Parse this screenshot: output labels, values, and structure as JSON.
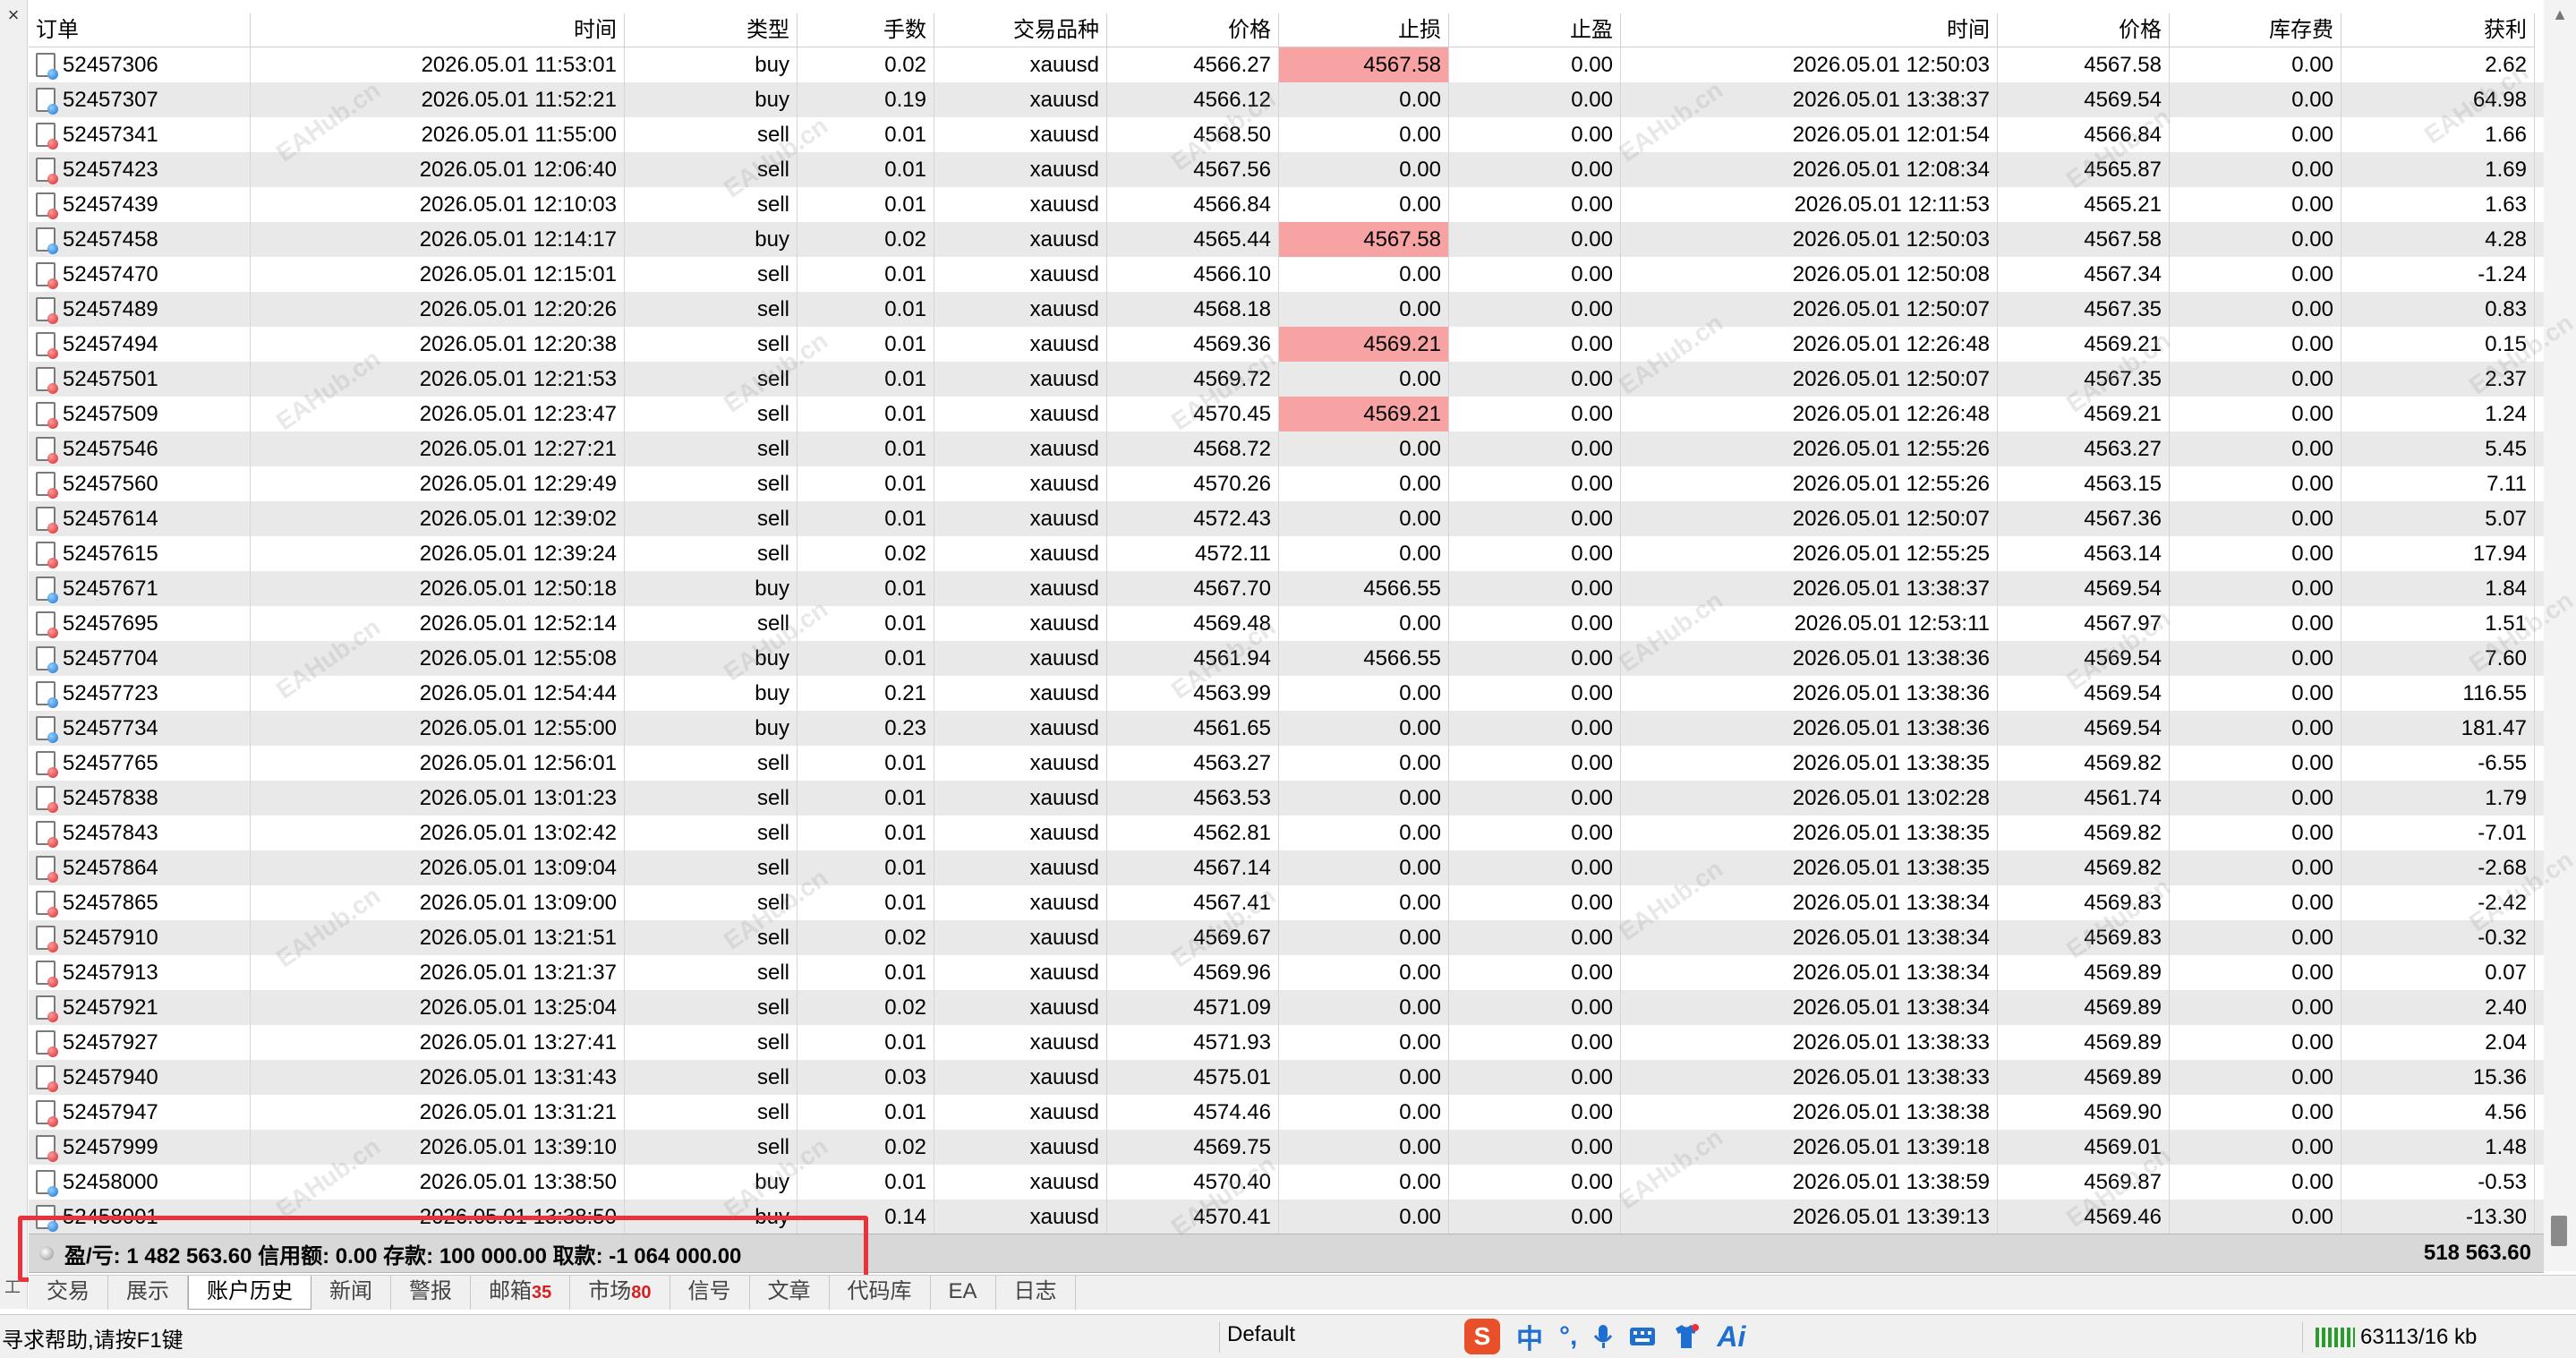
{
  "toolbox": {
    "close_glyph": "×",
    "title": "工具箱"
  },
  "columns": [
    "订单",
    "时间",
    "类型",
    "手数",
    "交易品种",
    "价格",
    "止损",
    "止盈",
    "时间",
    "价格",
    "库存费",
    "获利"
  ],
  "rows": [
    {
      "order": "52457306",
      "open_time": "2026.05.01 11:53:01",
      "type": "buy",
      "lots": "0.02",
      "symbol": "xauusd",
      "open_price": "4566.27",
      "sl": "4567.58",
      "sl_hit": true,
      "tp": "0.00",
      "close_time": "2026.05.01 12:50:03",
      "close_price": "4567.58",
      "swap": "0.00",
      "profit": "2.62"
    },
    {
      "order": "52457307",
      "open_time": "2026.05.01 11:52:21",
      "type": "buy",
      "lots": "0.19",
      "symbol": "xauusd",
      "open_price": "4566.12",
      "sl": "0.00",
      "sl_hit": false,
      "tp": "0.00",
      "close_time": "2026.05.01 13:38:37",
      "close_price": "4569.54",
      "swap": "0.00",
      "profit": "64.98"
    },
    {
      "order": "52457341",
      "open_time": "2026.05.01 11:55:00",
      "type": "sell",
      "lots": "0.01",
      "symbol": "xauusd",
      "open_price": "4568.50",
      "sl": "0.00",
      "sl_hit": false,
      "tp": "0.00",
      "close_time": "2026.05.01 12:01:54",
      "close_price": "4566.84",
      "swap": "0.00",
      "profit": "1.66"
    },
    {
      "order": "52457423",
      "open_time": "2026.05.01 12:06:40",
      "type": "sell",
      "lots": "0.01",
      "symbol": "xauusd",
      "open_price": "4567.56",
      "sl": "0.00",
      "sl_hit": false,
      "tp": "0.00",
      "close_time": "2026.05.01 12:08:34",
      "close_price": "4565.87",
      "swap": "0.00",
      "profit": "1.69"
    },
    {
      "order": "52457439",
      "open_time": "2026.05.01 12:10:03",
      "type": "sell",
      "lots": "0.01",
      "symbol": "xauusd",
      "open_price": "4566.84",
      "sl": "0.00",
      "sl_hit": false,
      "tp": "0.00",
      "close_time": "2026.05.01 12:11:53",
      "close_price": "4565.21",
      "swap": "0.00",
      "profit": "1.63"
    },
    {
      "order": "52457458",
      "open_time": "2026.05.01 12:14:17",
      "type": "buy",
      "lots": "0.02",
      "symbol": "xauusd",
      "open_price": "4565.44",
      "sl": "4567.58",
      "sl_hit": true,
      "tp": "0.00",
      "close_time": "2026.05.01 12:50:03",
      "close_price": "4567.58",
      "swap": "0.00",
      "profit": "4.28"
    },
    {
      "order": "52457470",
      "open_time": "2026.05.01 12:15:01",
      "type": "sell",
      "lots": "0.01",
      "symbol": "xauusd",
      "open_price": "4566.10",
      "sl": "0.00",
      "sl_hit": false,
      "tp": "0.00",
      "close_time": "2026.05.01 12:50:08",
      "close_price": "4567.34",
      "swap": "0.00",
      "profit": "-1.24"
    },
    {
      "order": "52457489",
      "open_time": "2026.05.01 12:20:26",
      "type": "sell",
      "lots": "0.01",
      "symbol": "xauusd",
      "open_price": "4568.18",
      "sl": "0.00",
      "sl_hit": false,
      "tp": "0.00",
      "close_time": "2026.05.01 12:50:07",
      "close_price": "4567.35",
      "swap": "0.00",
      "profit": "0.83"
    },
    {
      "order": "52457494",
      "open_time": "2026.05.01 12:20:38",
      "type": "sell",
      "lots": "0.01",
      "symbol": "xauusd",
      "open_price": "4569.36",
      "sl": "4569.21",
      "sl_hit": true,
      "tp": "0.00",
      "close_time": "2026.05.01 12:26:48",
      "close_price": "4569.21",
      "swap": "0.00",
      "profit": "0.15"
    },
    {
      "order": "52457501",
      "open_time": "2026.05.01 12:21:53",
      "type": "sell",
      "lots": "0.01",
      "symbol": "xauusd",
      "open_price": "4569.72",
      "sl": "0.00",
      "sl_hit": false,
      "tp": "0.00",
      "close_time": "2026.05.01 12:50:07",
      "close_price": "4567.35",
      "swap": "0.00",
      "profit": "2.37"
    },
    {
      "order": "52457509",
      "open_time": "2026.05.01 12:23:47",
      "type": "sell",
      "lots": "0.01",
      "symbol": "xauusd",
      "open_price": "4570.45",
      "sl": "4569.21",
      "sl_hit": true,
      "tp": "0.00",
      "close_time": "2026.05.01 12:26:48",
      "close_price": "4569.21",
      "swap": "0.00",
      "profit": "1.24"
    },
    {
      "order": "52457546",
      "open_time": "2026.05.01 12:27:21",
      "type": "sell",
      "lots": "0.01",
      "symbol": "xauusd",
      "open_price": "4568.72",
      "sl": "0.00",
      "sl_hit": false,
      "tp": "0.00",
      "close_time": "2026.05.01 12:55:26",
      "close_price": "4563.27",
      "swap": "0.00",
      "profit": "5.45"
    },
    {
      "order": "52457560",
      "open_time": "2026.05.01 12:29:49",
      "type": "sell",
      "lots": "0.01",
      "symbol": "xauusd",
      "open_price": "4570.26",
      "sl": "0.00",
      "sl_hit": false,
      "tp": "0.00",
      "close_time": "2026.05.01 12:55:26",
      "close_price": "4563.15",
      "swap": "0.00",
      "profit": "7.11"
    },
    {
      "order": "52457614",
      "open_time": "2026.05.01 12:39:02",
      "type": "sell",
      "lots": "0.01",
      "symbol": "xauusd",
      "open_price": "4572.43",
      "sl": "0.00",
      "sl_hit": false,
      "tp": "0.00",
      "close_time": "2026.05.01 12:50:07",
      "close_price": "4567.36",
      "swap": "0.00",
      "profit": "5.07"
    },
    {
      "order": "52457615",
      "open_time": "2026.05.01 12:39:24",
      "type": "sell",
      "lots": "0.02",
      "symbol": "xauusd",
      "open_price": "4572.11",
      "sl": "0.00",
      "sl_hit": false,
      "tp": "0.00",
      "close_time": "2026.05.01 12:55:25",
      "close_price": "4563.14",
      "swap": "0.00",
      "profit": "17.94"
    },
    {
      "order": "52457671",
      "open_time": "2026.05.01 12:50:18",
      "type": "buy",
      "lots": "0.01",
      "symbol": "xauusd",
      "open_price": "4567.70",
      "sl": "4566.55",
      "sl_hit": false,
      "tp": "0.00",
      "close_time": "2026.05.01 13:38:37",
      "close_price": "4569.54",
      "swap": "0.00",
      "profit": "1.84"
    },
    {
      "order": "52457695",
      "open_time": "2026.05.01 12:52:14",
      "type": "sell",
      "lots": "0.01",
      "symbol": "xauusd",
      "open_price": "4569.48",
      "sl": "0.00",
      "sl_hit": false,
      "tp": "0.00",
      "close_time": "2026.05.01 12:53:11",
      "close_price": "4567.97",
      "swap": "0.00",
      "profit": "1.51"
    },
    {
      "order": "52457704",
      "open_time": "2026.05.01 12:55:08",
      "type": "buy",
      "lots": "0.01",
      "symbol": "xauusd",
      "open_price": "4561.94",
      "sl": "4566.55",
      "sl_hit": false,
      "tp": "0.00",
      "close_time": "2026.05.01 13:38:36",
      "close_price": "4569.54",
      "swap": "0.00",
      "profit": "7.60"
    },
    {
      "order": "52457723",
      "open_time": "2026.05.01 12:54:44",
      "type": "buy",
      "lots": "0.21",
      "symbol": "xauusd",
      "open_price": "4563.99",
      "sl": "0.00",
      "sl_hit": false,
      "tp": "0.00",
      "close_time": "2026.05.01 13:38:36",
      "close_price": "4569.54",
      "swap": "0.00",
      "profit": "116.55"
    },
    {
      "order": "52457734",
      "open_time": "2026.05.01 12:55:00",
      "type": "buy",
      "lots": "0.23",
      "symbol": "xauusd",
      "open_price": "4561.65",
      "sl": "0.00",
      "sl_hit": false,
      "tp": "0.00",
      "close_time": "2026.05.01 13:38:36",
      "close_price": "4569.54",
      "swap": "0.00",
      "profit": "181.47"
    },
    {
      "order": "52457765",
      "open_time": "2026.05.01 12:56:01",
      "type": "sell",
      "lots": "0.01",
      "symbol": "xauusd",
      "open_price": "4563.27",
      "sl": "0.00",
      "sl_hit": false,
      "tp": "0.00",
      "close_time": "2026.05.01 13:38:35",
      "close_price": "4569.82",
      "swap": "0.00",
      "profit": "-6.55"
    },
    {
      "order": "52457838",
      "open_time": "2026.05.01 13:01:23",
      "type": "sell",
      "lots": "0.01",
      "symbol": "xauusd",
      "open_price": "4563.53",
      "sl": "0.00",
      "sl_hit": false,
      "tp": "0.00",
      "close_time": "2026.05.01 13:02:28",
      "close_price": "4561.74",
      "swap": "0.00",
      "profit": "1.79"
    },
    {
      "order": "52457843",
      "open_time": "2026.05.01 13:02:42",
      "type": "sell",
      "lots": "0.01",
      "symbol": "xauusd",
      "open_price": "4562.81",
      "sl": "0.00",
      "sl_hit": false,
      "tp": "0.00",
      "close_time": "2026.05.01 13:38:35",
      "close_price": "4569.82",
      "swap": "0.00",
      "profit": "-7.01"
    },
    {
      "order": "52457864",
      "open_time": "2026.05.01 13:09:04",
      "type": "sell",
      "lots": "0.01",
      "symbol": "xauusd",
      "open_price": "4567.14",
      "sl": "0.00",
      "sl_hit": false,
      "tp": "0.00",
      "close_time": "2026.05.01 13:38:35",
      "close_price": "4569.82",
      "swap": "0.00",
      "profit": "-2.68"
    },
    {
      "order": "52457865",
      "open_time": "2026.05.01 13:09:00",
      "type": "sell",
      "lots": "0.01",
      "symbol": "xauusd",
      "open_price": "4567.41",
      "sl": "0.00",
      "sl_hit": false,
      "tp": "0.00",
      "close_time": "2026.05.01 13:38:34",
      "close_price": "4569.83",
      "swap": "0.00",
      "profit": "-2.42"
    },
    {
      "order": "52457910",
      "open_time": "2026.05.01 13:21:51",
      "type": "sell",
      "lots": "0.02",
      "symbol": "xauusd",
      "open_price": "4569.67",
      "sl": "0.00",
      "sl_hit": false,
      "tp": "0.00",
      "close_time": "2026.05.01 13:38:34",
      "close_price": "4569.83",
      "swap": "0.00",
      "profit": "-0.32"
    },
    {
      "order": "52457913",
      "open_time": "2026.05.01 13:21:37",
      "type": "sell",
      "lots": "0.01",
      "symbol": "xauusd",
      "open_price": "4569.96",
      "sl": "0.00",
      "sl_hit": false,
      "tp": "0.00",
      "close_time": "2026.05.01 13:38:34",
      "close_price": "4569.89",
      "swap": "0.00",
      "profit": "0.07"
    },
    {
      "order": "52457921",
      "open_time": "2026.05.01 13:25:04",
      "type": "sell",
      "lots": "0.02",
      "symbol": "xauusd",
      "open_price": "4571.09",
      "sl": "0.00",
      "sl_hit": false,
      "tp": "0.00",
      "close_time": "2026.05.01 13:38:34",
      "close_price": "4569.89",
      "swap": "0.00",
      "profit": "2.40"
    },
    {
      "order": "52457927",
      "open_time": "2026.05.01 13:27:41",
      "type": "sell",
      "lots": "0.01",
      "symbol": "xauusd",
      "open_price": "4571.93",
      "sl": "0.00",
      "sl_hit": false,
      "tp": "0.00",
      "close_time": "2026.05.01 13:38:33",
      "close_price": "4569.89",
      "swap": "0.00",
      "profit": "2.04"
    },
    {
      "order": "52457940",
      "open_time": "2026.05.01 13:31:43",
      "type": "sell",
      "lots": "0.03",
      "symbol": "xauusd",
      "open_price": "4575.01",
      "sl": "0.00",
      "sl_hit": false,
      "tp": "0.00",
      "close_time": "2026.05.01 13:38:33",
      "close_price": "4569.89",
      "swap": "0.00",
      "profit": "15.36"
    },
    {
      "order": "52457947",
      "open_time": "2026.05.01 13:31:21",
      "type": "sell",
      "lots": "0.01",
      "symbol": "xauusd",
      "open_price": "4574.46",
      "sl": "0.00",
      "sl_hit": false,
      "tp": "0.00",
      "close_time": "2026.05.01 13:38:38",
      "close_price": "4569.90",
      "swap": "0.00",
      "profit": "4.56"
    },
    {
      "order": "52457999",
      "open_time": "2026.05.01 13:39:10",
      "type": "sell",
      "lots": "0.02",
      "symbol": "xauusd",
      "open_price": "4569.75",
      "sl": "0.00",
      "sl_hit": false,
      "tp": "0.00",
      "close_time": "2026.05.01 13:39:18",
      "close_price": "4569.01",
      "swap": "0.00",
      "profit": "1.48"
    },
    {
      "order": "52458000",
      "open_time": "2026.05.01 13:38:50",
      "type": "buy",
      "lots": "0.01",
      "symbol": "xauusd",
      "open_price": "4570.40",
      "sl": "0.00",
      "sl_hit": false,
      "tp": "0.00",
      "close_time": "2026.05.01 13:38:59",
      "close_price": "4569.87",
      "swap": "0.00",
      "profit": "-0.53"
    },
    {
      "order": "52458001",
      "open_time": "2026.05.01 13:38:50",
      "type": "buy",
      "lots": "0.14",
      "symbol": "xauusd",
      "open_price": "4570.41",
      "sl": "0.00",
      "sl_hit": false,
      "tp": "0.00",
      "close_time": "2026.05.01 13:39:13",
      "close_price": "4569.46",
      "swap": "0.00",
      "profit": "-13.30"
    }
  ],
  "summary": {
    "text": "盈/亏: 1 482 563.60  信用额: 0.00  存款: 100 000.00  取款: -1 064 000.00",
    "total": "518 563.60"
  },
  "tabs": [
    {
      "label": "交易",
      "count": "",
      "active": false
    },
    {
      "label": "展示",
      "count": "",
      "active": false
    },
    {
      "label": "账户历史",
      "count": "",
      "active": true
    },
    {
      "label": "新闻",
      "count": "",
      "active": false
    },
    {
      "label": "警报",
      "count": "",
      "active": false
    },
    {
      "label": "邮箱",
      "count": "35",
      "active": false
    },
    {
      "label": "市场",
      "count": "80",
      "active": false
    },
    {
      "label": "信号",
      "count": "",
      "active": false
    },
    {
      "label": "文章",
      "count": "",
      "active": false
    },
    {
      "label": "代码库",
      "count": "",
      "active": false
    },
    {
      "label": "EA",
      "count": "",
      "active": false
    },
    {
      "label": "日志",
      "count": "",
      "active": false
    }
  ],
  "status": {
    "help": "寻求帮助,请按F1键",
    "profile": "Default",
    "ime_logo": "S",
    "ime_lang": "中",
    "ime_punct": "°,",
    "ime_ai": "Ai",
    "connection": "63113/16 kb"
  },
  "watermark": "EAHub.cn",
  "colors": {
    "sl_highlight": "#f7a3a3",
    "highlight_box": "#e8323c",
    "row_alt": "#e9e9e9",
    "tab_count": "#d42020"
  }
}
